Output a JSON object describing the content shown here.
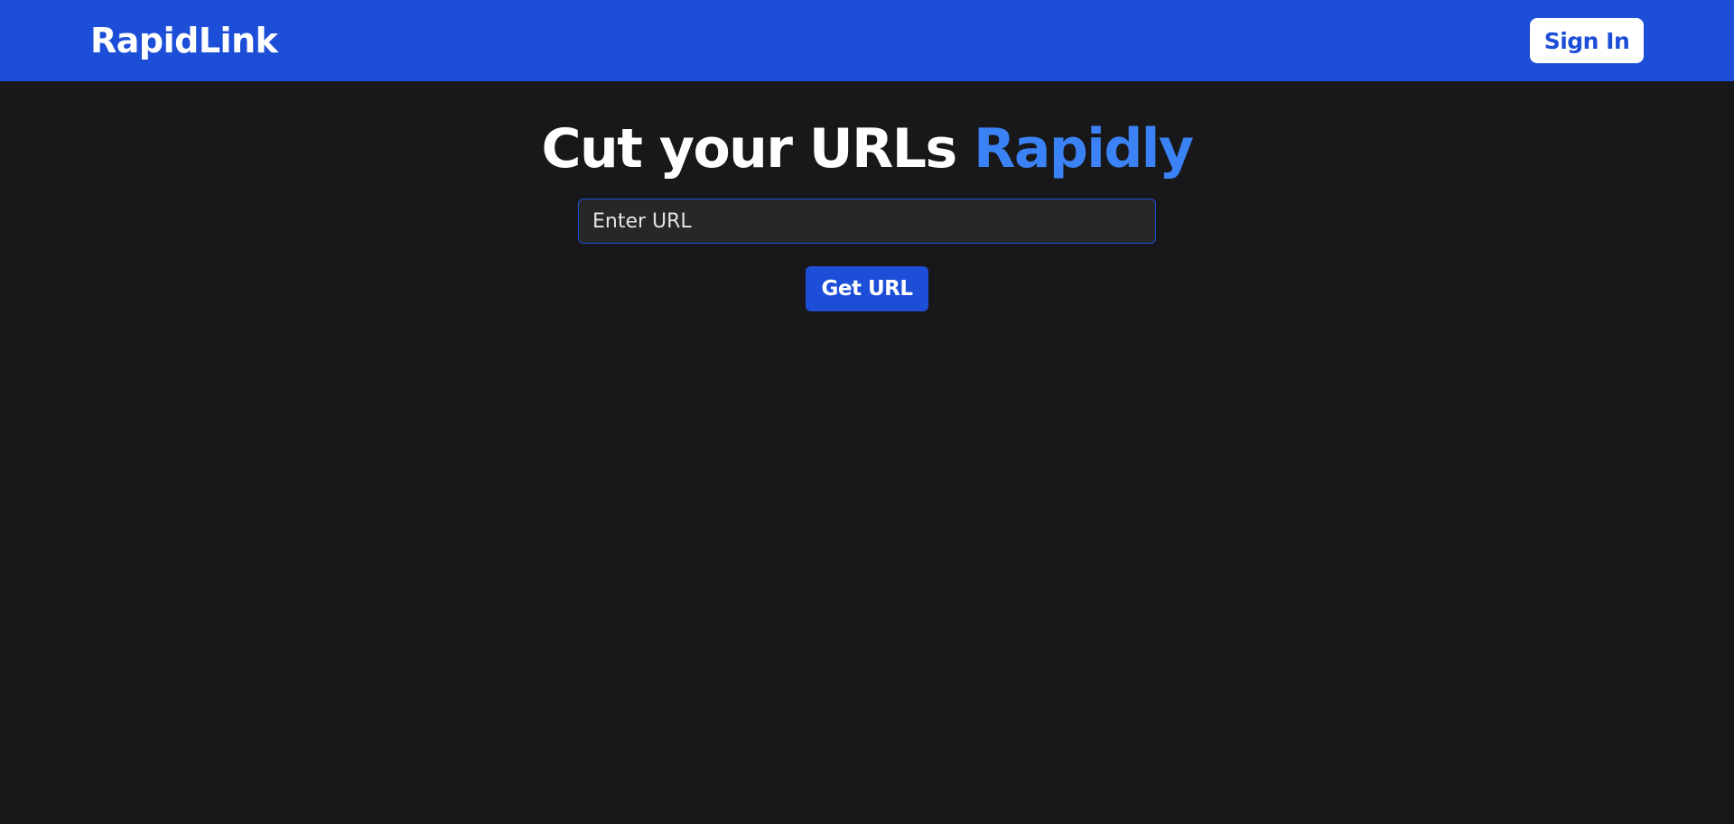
{
  "header": {
    "brand": "RapidLink",
    "sign_in_label": "Sign In"
  },
  "hero": {
    "title_main": "Cut your URLs",
    "title_accent": "Rapidly"
  },
  "form": {
    "url_value": "",
    "url_placeholder": "Enter URL",
    "submit_label": "Get URL"
  },
  "colors": {
    "primary": "#1d4ed8",
    "accent": "#3b82f6",
    "background": "#18181b",
    "input_background": "#27272a"
  }
}
